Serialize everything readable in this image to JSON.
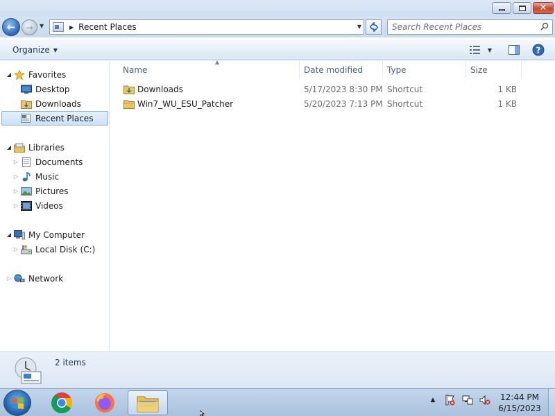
{
  "window": {
    "caption_buttons": [
      "minimize",
      "maximize",
      "close"
    ]
  },
  "address_bar": {
    "location": "Recent Places"
  },
  "search": {
    "placeholder": "Search Recent Places"
  },
  "toolbar": {
    "organize_label": "Organize"
  },
  "nav_pane": {
    "favorites": {
      "label": "Favorites",
      "items": [
        {
          "label": "Desktop",
          "icon": "desktop-icon"
        },
        {
          "label": "Downloads",
          "icon": "downloads-folder-icon"
        },
        {
          "label": "Recent Places",
          "icon": "recent-places-icon",
          "selected": true
        }
      ]
    },
    "libraries": {
      "label": "Libraries",
      "items": [
        {
          "label": "Documents",
          "icon": "documents-icon"
        },
        {
          "label": "Music",
          "icon": "music-icon"
        },
        {
          "label": "Pictures",
          "icon": "pictures-icon"
        },
        {
          "label": "Videos",
          "icon": "videos-icon"
        }
      ]
    },
    "computer": {
      "label": "My Computer",
      "items": [
        {
          "label": "Local Disk (C:)",
          "icon": "local-disk-icon"
        }
      ]
    },
    "network": {
      "label": "Network"
    }
  },
  "columns": {
    "name": "Name",
    "date_modified": "Date modified",
    "type": "Type",
    "size": "Size"
  },
  "files": [
    {
      "name": "Downloads",
      "date_modified": "5/17/2023 8:30 PM",
      "type": "Shortcut",
      "size": "1 KB"
    },
    {
      "name": "Win7_WU_ESU_Patcher",
      "date_modified": "5/20/2023 7:13 PM",
      "type": "Shortcut",
      "size": "1 KB"
    }
  ],
  "details": {
    "item_count": "2 items"
  },
  "taskbar": {
    "pinned": [
      "start-orb",
      "chrome-icon",
      "firefox-icon",
      "explorer-icon"
    ],
    "time": "12:44 PM",
    "date": "6/15/2023"
  },
  "colors": {
    "accent": "#2d68b4",
    "selection": "#cce1f6",
    "header_text": "#4c607a",
    "secondary_text": "#6d6d6d"
  }
}
